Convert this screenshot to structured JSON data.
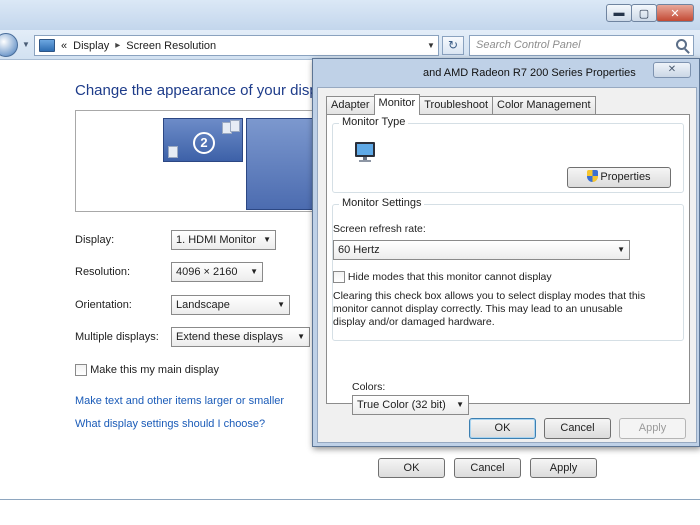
{
  "window": {
    "caption": {
      "minimize": "▬",
      "maximize": "▢",
      "close": "✕"
    }
  },
  "address": {
    "prefix": "«",
    "crumbs": [
      "Display",
      "Screen Resolution"
    ],
    "separator": "▸",
    "search_placeholder": "Search Control Panel"
  },
  "main": {
    "title": "Change the appearance of your displa",
    "preview": {
      "selected_monitor": "2"
    },
    "display_label": "Display:",
    "display_value": "1. HDMI Monitor",
    "resolution_label": "Resolution:",
    "resolution_value": "4096 × 2160",
    "orientation_label": "Orientation:",
    "orientation_value": "Landscape",
    "multiple_label": "Multiple displays:",
    "multiple_value": "Extend these displays",
    "main_display_label": "Make this my main display",
    "main_display_checked": false,
    "link_text_size": "Make text and other items larger or smaller",
    "link_help": "What display settings should I choose?",
    "ok": "OK",
    "cancel": "Cancel",
    "apply": "Apply"
  },
  "dialog": {
    "title": "and AMD Radeon R7 200 Series Properties",
    "close": "✕",
    "tabs": [
      "Adapter",
      "Monitor",
      "Troubleshoot",
      "Color Management"
    ],
    "active_tab": "Monitor",
    "monitor_type_label": "Monitor Type",
    "properties_btn": "Properties",
    "monitor_settings_label": "Monitor Settings",
    "refresh_label": "Screen refresh rate:",
    "refresh_value": "60 Hertz",
    "hide_modes_label": "Hide modes that this monitor cannot display",
    "hide_modes_checked": false,
    "hide_modes_desc": [
      "Clearing this check box allows you to select display modes that this",
      "monitor cannot display correctly. This may lead to an unusable",
      "display and/or damaged hardware."
    ],
    "colors_label": "Colors:",
    "colors_value": "True Color (32 bit)",
    "ok": "OK",
    "cancel": "Cancel",
    "apply": "Apply"
  },
  "colors": {
    "title_blue": "#1e3c8a",
    "link_blue": "#1a5bb8",
    "dialog_frame": "#bfd1e7"
  }
}
